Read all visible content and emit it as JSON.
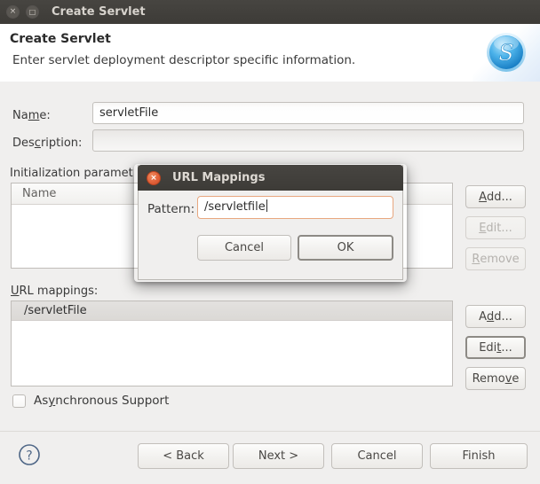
{
  "window": {
    "title": "Create Servlet",
    "close_icon": "close-icon",
    "maximize_icon": "maximize-icon",
    "close_glyph": "×",
    "maximize_glyph": "□"
  },
  "header": {
    "title": "Create Servlet",
    "description": "Enter servlet deployment descriptor specific information.",
    "banner_icon": "servlet-s-icon",
    "banner_letter": "S"
  },
  "form": {
    "name_label_pre": "Na",
    "name_label_mnemonic": "m",
    "name_label_post": "e:",
    "name_value": "servletFile",
    "name_placeholder": "",
    "description_label_pre": "Des",
    "description_label_mnemonic": "c",
    "description_label_post": "ription:",
    "description_value": "",
    "description_placeholder": ""
  },
  "init_params": {
    "label": "Initialization paramet",
    "column_header": "Name",
    "rows": [],
    "buttons": [
      {
        "label_pre": "",
        "mnemonic": "A",
        "label_post": "dd...",
        "name": "init-add-button",
        "disabled": false
      },
      {
        "label_pre": "",
        "mnemonic": "E",
        "label_post": "dit...",
        "name": "init-edit-button",
        "disabled": true
      },
      {
        "label_pre": "",
        "mnemonic": "R",
        "label_post": "emove",
        "name": "init-remove-button",
        "disabled": true
      }
    ]
  },
  "url_mappings": {
    "label_pre": "",
    "label_mnemonic": "U",
    "label_post": "RL mappings:",
    "rows": [
      "/servletFile"
    ],
    "buttons": [
      {
        "label_pre": "A",
        "mnemonic": "d",
        "label_post": "d...",
        "name": "url-add-button",
        "disabled": false,
        "focused": false
      },
      {
        "label_pre": "Edi",
        "mnemonic": "t",
        "label_post": "...",
        "name": "url-edit-button",
        "disabled": false,
        "focused": true
      },
      {
        "label_pre": "Remo",
        "mnemonic": "v",
        "label_post": "e",
        "name": "url-remove-button",
        "disabled": false,
        "focused": false
      }
    ]
  },
  "async": {
    "label_pre": "As",
    "label_mnemonic": "y",
    "label_post": "nchronous Support",
    "checked": false
  },
  "footer": {
    "help_icon": "help-icon",
    "help_glyph": "?",
    "buttons": [
      {
        "label": "< Back",
        "name": "back-button"
      },
      {
        "label": "Next >",
        "name": "next-button"
      },
      {
        "label": "Cancel",
        "name": "cancel-button"
      },
      {
        "label": "Finish",
        "name": "finish-button"
      }
    ]
  },
  "modal": {
    "title": "URL Mappings",
    "close_icon": "close-icon",
    "close_glyph": "×",
    "pattern_label": "Pattern:",
    "pattern_value": "/servletfile",
    "pattern_placeholder": "",
    "cancel_label": "Cancel",
    "ok_label": "OK"
  },
  "colors": {
    "titlebar": "#3d3b37",
    "window_bg": "#f0efee",
    "close_accent": "#e2623a",
    "focus_border": "#e8a77f",
    "help_icon": "#4e6686"
  }
}
